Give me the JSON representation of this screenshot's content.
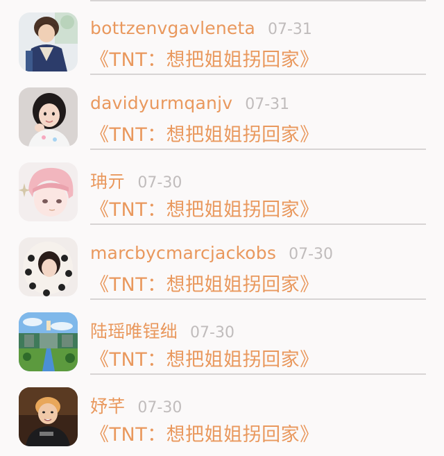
{
  "feed": {
    "items": [
      {
        "username": "bottzenvgavleneta",
        "time": "07-31",
        "title": "《TNT：想把姐姐拐回家》",
        "avatar": "anime-character-avatar"
      },
      {
        "username": "davidyurmqanjv",
        "time": "07-31",
        "title": "《TNT：想把姐姐拐回家》",
        "avatar": "girl-photo-avatar"
      },
      {
        "username": "珃亓",
        "time": "07-30",
        "title": "《TNT：想把姐姐拐回家》",
        "avatar": "pink-anime-avatar"
      },
      {
        "username": "marcbycmarcjackobs",
        "time": "07-30",
        "title": "《TNT：想把姐姐拐回家》",
        "avatar": "girl-hood-avatar"
      },
      {
        "username": "陆瑶唯锃绌",
        "time": "07-30",
        "title": "《TNT：想把姐姐拐回家》",
        "avatar": "landscape-painting-avatar"
      },
      {
        "username": "妤芊",
        "time": "07-30",
        "title": "《TNT：想把姐姐拐回家》",
        "avatar": "boy-photo-avatar"
      }
    ]
  }
}
